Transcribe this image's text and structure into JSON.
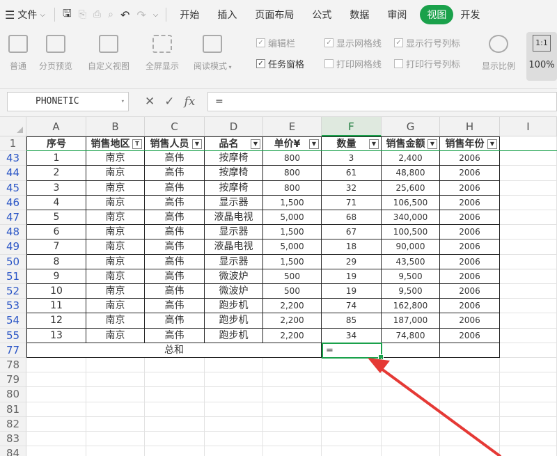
{
  "menubar": {
    "file_label": "文件",
    "tabs": [
      "开始",
      "插入",
      "页面布局",
      "公式",
      "数据",
      "审阅",
      "视图",
      "开发"
    ],
    "active_tab": "视图"
  },
  "ribbon": {
    "buttons": [
      "普通",
      "分页预览",
      "自定义视图",
      "全屏显示",
      "阅读模式",
      "显示比例",
      "100%"
    ],
    "checkboxes": [
      {
        "label": "编辑栏",
        "checked": true,
        "enabled": false
      },
      {
        "label": "显示网格线",
        "checked": true,
        "enabled": false
      },
      {
        "label": "显示行号列标",
        "checked": true,
        "enabled": false
      },
      {
        "label": "任务窗格",
        "checked": true,
        "enabled": true
      },
      {
        "label": "打印网格线",
        "checked": false,
        "enabled": false
      },
      {
        "label": "打印行号列标",
        "checked": false,
        "enabled": false
      }
    ],
    "zoom_icon_text": "1:1"
  },
  "formula": {
    "name_box": "PHONETIC",
    "fx_label": "fx",
    "content": "="
  },
  "columns": [
    "A",
    "B",
    "C",
    "D",
    "E",
    "F",
    "G",
    "H",
    "I"
  ],
  "selected_column": "F",
  "header_row": {
    "row_number": "1",
    "cells": [
      "序号",
      "销售地区",
      "销售人员",
      "品名",
      "单价¥",
      "数量",
      "销售金额",
      "销售年份"
    ]
  },
  "rows": [
    {
      "n": "43",
      "cells": [
        "1",
        "南京",
        "高伟",
        "按摩椅",
        "800",
        "3",
        "2,400",
        "2006"
      ]
    },
    {
      "n": "44",
      "cells": [
        "2",
        "南京",
        "高伟",
        "按摩椅",
        "800",
        "61",
        "48,800",
        "2006"
      ]
    },
    {
      "n": "45",
      "cells": [
        "3",
        "南京",
        "高伟",
        "按摩椅",
        "800",
        "32",
        "25,600",
        "2006"
      ]
    },
    {
      "n": "46",
      "cells": [
        "4",
        "南京",
        "高伟",
        "显示器",
        "1,500",
        "71",
        "106,500",
        "2006"
      ]
    },
    {
      "n": "47",
      "cells": [
        "5",
        "南京",
        "高伟",
        "液晶电视",
        "5,000",
        "68",
        "340,000",
        "2006"
      ]
    },
    {
      "n": "48",
      "cells": [
        "6",
        "南京",
        "高伟",
        "显示器",
        "1,500",
        "67",
        "100,500",
        "2006"
      ]
    },
    {
      "n": "49",
      "cells": [
        "7",
        "南京",
        "高伟",
        "液晶电视",
        "5,000",
        "18",
        "90,000",
        "2006"
      ]
    },
    {
      "n": "50",
      "cells": [
        "8",
        "南京",
        "高伟",
        "显示器",
        "1,500",
        "29",
        "43,500",
        "2006"
      ]
    },
    {
      "n": "51",
      "cells": [
        "9",
        "南京",
        "高伟",
        "微波炉",
        "500",
        "19",
        "9,500",
        "2006"
      ]
    },
    {
      "n": "52",
      "cells": [
        "10",
        "南京",
        "高伟",
        "微波炉",
        "500",
        "19",
        "9,500",
        "2006"
      ]
    },
    {
      "n": "53",
      "cells": [
        "11",
        "南京",
        "高伟",
        "跑步机",
        "2,200",
        "74",
        "162,800",
        "2006"
      ]
    },
    {
      "n": "54",
      "cells": [
        "12",
        "南京",
        "高伟",
        "跑步机",
        "2,200",
        "85",
        "187,000",
        "2006"
      ]
    },
    {
      "n": "55",
      "cells": [
        "13",
        "南京",
        "高伟",
        "跑步机",
        "2,200",
        "34",
        "74,800",
        "2006"
      ]
    }
  ],
  "total_row": {
    "n": "77",
    "label": "总和",
    "formula": "="
  },
  "empty_rows": [
    "78",
    "79",
    "80",
    "81",
    "82",
    "83",
    "84"
  ]
}
